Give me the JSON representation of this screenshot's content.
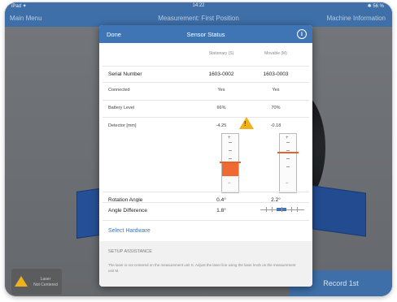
{
  "statusbar": {
    "left": "iPad ✦",
    "time": "14:22",
    "right": "✱ 56 %"
  },
  "navbar": {
    "left": "Main Menu",
    "title": "Measurement: First Position",
    "right": "Machine Information"
  },
  "modal": {
    "done_label": "Done",
    "title": "Sensor Status",
    "info_icon": "info-circle-icon",
    "columns": {
      "stationary": "Stationary (S)",
      "movable": "Movable (M)"
    },
    "rows": {
      "serial": {
        "label": "Serial Number",
        "s": "1603-0002",
        "m": "1603-0003"
      },
      "connected": {
        "label": "Connected",
        "s": "Yes",
        "m": "Yes"
      },
      "battery": {
        "label": "Battery Level",
        "s": "66%",
        "m": "70%"
      },
      "detector": {
        "label": "Detector [mm]",
        "s": "-4.25",
        "m": "-0.18"
      },
      "rotation": {
        "label": "Rotation Angle",
        "s": "0.4°",
        "m": "2.2°"
      },
      "angle_diff": {
        "label": "Angle Difference",
        "s": "1.8°"
      }
    },
    "warning_icon": "warning-triangle-icon",
    "warning_symbol": "!",
    "gauge_s_plus": "+",
    "gauge_s_minus": "−",
    "gauge_m_plus": "+",
    "gauge_m_minus": "−",
    "select_hardware": "Select Hardware",
    "setup_title": "SETUP ASSISTANCE",
    "setup_text": "The laser is not centered on the measurement unit S. Adjust the laser line using the laser knob on the measurement unit M."
  },
  "bottom": {
    "warning_line1": "Laser",
    "warning_line2": "Not Centered",
    "record_label": "Record 1st"
  },
  "colors": {
    "accent": "#3f74b5",
    "warning": "#f0b21b",
    "detector_marker": "#ef6a33"
  }
}
